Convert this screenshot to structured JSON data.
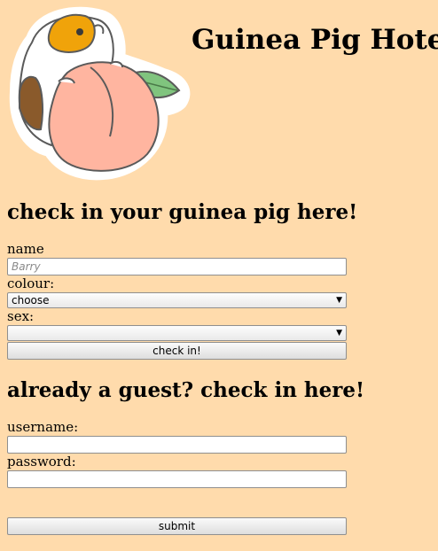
{
  "header": {
    "title": "Guinea Pig Hotel",
    "logo_icon": "guinea-pig-peach-sticker-icon"
  },
  "checkin_form": {
    "heading": "check in your guinea pig here!",
    "name_label": "name",
    "name_placeholder": "Barry",
    "name_value": "",
    "colour_label": "colour:",
    "colour_selected": "choose",
    "sex_label": "sex:",
    "sex_selected": "",
    "dropdown_icon": "triangle-down-icon",
    "submit_label": "check in!"
  },
  "guest_form": {
    "heading": "already a guest? check in here!",
    "username_label": "username:",
    "username_value": "",
    "password_label": "password:",
    "password_value": "",
    "submit_label": "submit"
  },
  "colors": {
    "page_background": "#ffdbac",
    "peach": "#ffb5a0",
    "leaf": "#80c47e",
    "guinea_pig_orange": "#f0a30a",
    "guinea_pig_brown": "#8a5a2b"
  }
}
